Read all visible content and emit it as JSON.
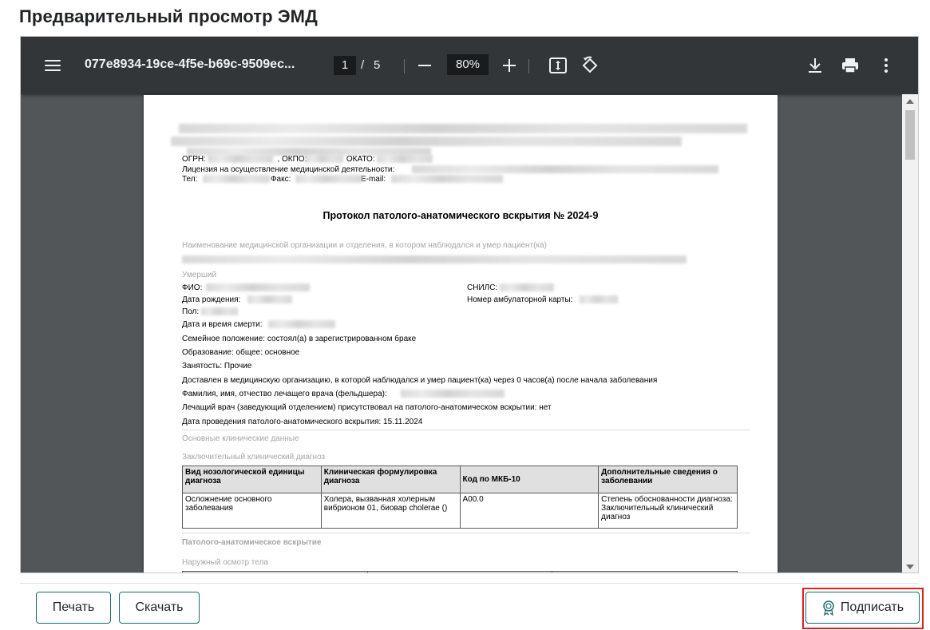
{
  "page_title": "Предварительный просмотр ЭМД",
  "viewer": {
    "doc_name": "077e8934-19ce-4f5e-b69c-9509ec...",
    "current_page": "1",
    "separator": "/",
    "total_pages": "5",
    "zoom": "80%"
  },
  "document": {
    "header_lines": {
      "ogrn": "ОГРН:",
      "okpo": ", ОКПО:",
      "okato": "ОКАТО:",
      "license": "Лицензия на осуществление медицинской деятельности:",
      "tel": "Тел:",
      "fax": "Факс:",
      "email": "E-mail:"
    },
    "title": "Протокол патолого-анатомического вскрытия № 2024-9",
    "org_section_label": "Наименование медицинской организации и отделения, в котором наблюдался и умер пациент(ка)",
    "deceased_label": "Умерший",
    "fio_label": "ФИО:",
    "snils_label": "СНИЛС:",
    "birth_label": "Дата рождения:",
    "card_label": "Номер амбулаторной карты:",
    "sex_label": "Пол:",
    "death_label": "Дата и время смерти:",
    "marital": "Семейное положение: состоял(а) в зарегистрированном браке",
    "education": "Образование: общее: основное",
    "employment": "Занятость: Прочие",
    "delivered": "Доставлен в медицинскую организацию, в которой наблюдался и умер пациент(ка) через 0 часов(а) после начала заболевания",
    "doctor_label": "Фамилия, имя, отчество лечащего врача (фельдшера):",
    "attended": "Лечащий врач (заведующий отделением) присутствовал на патолого-анатомическом вскрытии: нет",
    "autopsy_date": "Дата проведения патолого-анатомического вскрытия: 15.11.2024",
    "clinical_section": "Основные клинические данные",
    "final_diagnosis": "Заключительный клинический диагноз",
    "table_headers": [
      "Вид нозологической единицы диагноза",
      "Клиническая формулировка диагноза",
      "Код по МКБ-10",
      "Дополнительные сведения о заболевании"
    ],
    "table_row": [
      "Осложнение основного заболевания",
      "Холера, вызванная холерным вибрионом 01, биовар cholerae ()",
      "A00.0",
      "Степень обоснованности диагноза: Заключительный клинический диагноз"
    ],
    "autopsy_section": "Патолого-анатомическое вскрытие",
    "external_exam": "Наружный осмотр тела"
  },
  "buttons": {
    "print": "Печать",
    "download": "Скачать",
    "sign": "Подписать"
  }
}
